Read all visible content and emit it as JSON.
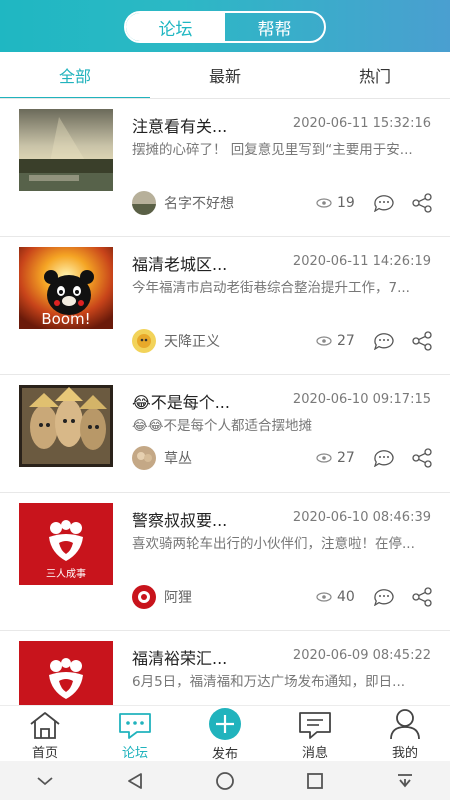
{
  "header": {
    "segments": [
      {
        "label": "论坛",
        "active": true
      },
      {
        "label": "帮帮",
        "active": false
      }
    ]
  },
  "subtabs": [
    {
      "label": "全部",
      "active": true
    },
    {
      "label": "最新",
      "active": false
    },
    {
      "label": "热门",
      "active": false
    }
  ],
  "posts": [
    {
      "title": "注意看有关...",
      "date": "2020-06-11 15:32:16",
      "excerpt": "摆摊的心碎了！ 回复意见里写到“主要用于安...",
      "author": "名字不好想",
      "views": "19"
    },
    {
      "title": "福清老城区...",
      "date": "2020-06-11 14:26:19",
      "excerpt": "今年福清市启动老街巷综合整治提升工作，7...",
      "author": "天降正义",
      "views": "27",
      "thumb_text": "Boom!"
    },
    {
      "title": "😂不是每个...",
      "date": "2020-06-10 09:17:15",
      "excerpt": "😂😂不是每个人都适合摆地摊",
      "author": "草丛",
      "views": "27"
    },
    {
      "title": "警察叔叔要...",
      "date": "2020-06-10 08:46:39",
      "excerpt": "喜欢骑两轮车出行的小伙伴们，注意啦！在停...",
      "author": "阿狸",
      "views": "40",
      "thumb_text": "三人成事"
    },
    {
      "title": "福清裕荣汇...",
      "date": "2020-06-09 08:45:22",
      "excerpt": "6月5日，福清福和万达广场发布通知，即日...",
      "author": "",
      "views": ""
    }
  ],
  "bottom_nav": [
    {
      "label": "首页",
      "icon": "home-icon",
      "active": false
    },
    {
      "label": "论坛",
      "icon": "forum-chat-icon",
      "active": true
    },
    {
      "label": "发布",
      "icon": "plus-circle-icon",
      "active": false
    },
    {
      "label": "消息",
      "icon": "message-icon",
      "active": false
    },
    {
      "label": "我的",
      "icon": "user-icon",
      "active": false
    }
  ],
  "colors": {
    "accent": "#21b3bd",
    "brand_red": "#c8141c"
  }
}
